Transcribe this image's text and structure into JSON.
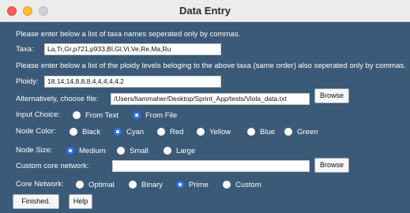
{
  "window": {
    "title": "Data Entry"
  },
  "taxa": {
    "instruction": "Please enter below a list of taxa names seperated only by commas.",
    "label": "Taxa:",
    "value": "La,Tr,Gr,p721,p933,Bl,Gl,Vi,Ve,Re,Ma,Ru"
  },
  "ploidy": {
    "instruction": "Please enter below a list of the ploidy levels beloging to the above taxa (same order) also seperated only by commas.",
    "label": "Ploidy:",
    "value": "18,14,14,8,8,8,4,4,4,4,4,2"
  },
  "file": {
    "label": "Alternatively, choose file:",
    "value": "/Users/liammaher/Desktop/Sprint_App/tests/Viola_data.txt",
    "browse_label": "Browse"
  },
  "input_choice": {
    "label": "Input Choice:",
    "options": [
      "From Text",
      "From File"
    ],
    "selected": "From File"
  },
  "node_color": {
    "label": "Node Color:",
    "options": [
      "Black",
      "Cyan",
      "Red",
      "Yellow",
      "Blue",
      "Green"
    ],
    "selected": "Cyan"
  },
  "node_size": {
    "label": "Node Size:",
    "options": [
      "Medium",
      "Small",
      "Large"
    ],
    "selected": "Medium"
  },
  "custom_core": {
    "label": "Custom core network:",
    "value": "",
    "browse_label": "Browse"
  },
  "core_network": {
    "label": "Core Network:",
    "options": [
      "Optimal",
      "Binary",
      "Prime",
      "Custom"
    ],
    "selected": "Prime"
  },
  "actions": {
    "finished_label": "Finished.",
    "help_label": "Help"
  },
  "colors": {
    "background": "#3a5a78",
    "radio_selected": "#2f6ff0",
    "close": "#fe5f57",
    "minimize": "#febc2e"
  }
}
